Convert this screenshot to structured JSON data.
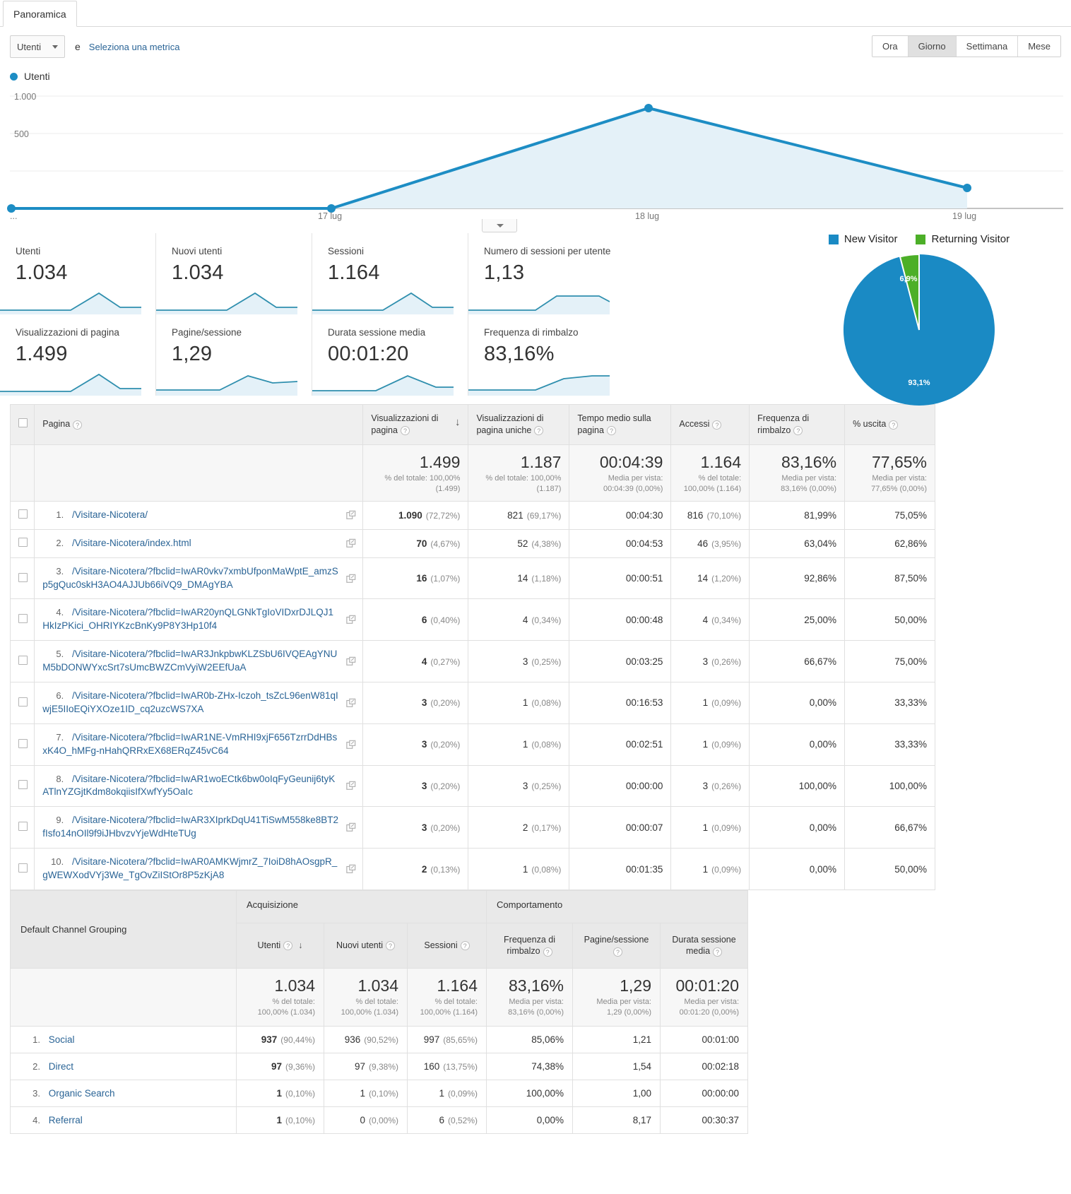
{
  "tab": {
    "label": "Panoramica"
  },
  "controls": {
    "metric_selected": "Utenti",
    "conjunction": "e",
    "select_metric_link": "Seleziona una metrica",
    "granularity": [
      {
        "label": "Ora",
        "active": false
      },
      {
        "label": "Giorno",
        "active": true
      },
      {
        "label": "Settimana",
        "active": false
      },
      {
        "label": "Mese",
        "active": false
      }
    ]
  },
  "chart_data": [
    {
      "type": "area",
      "title": "Utenti",
      "legend": [
        "Utenti"
      ],
      "legend_position": "top-left",
      "x": [
        "...",
        "17 lug",
        "18 lug",
        "19 lug"
      ],
      "series": [
        {
          "name": "Utenti",
          "values": [
            0,
            0,
            870,
            164
          ]
        }
      ],
      "ylim": [
        0,
        1100
      ],
      "yticks": [
        500,
        1000
      ],
      "ytick_labels": [
        "500",
        "1.000"
      ],
      "grid": true,
      "color": "#1d8dc4",
      "fill": "#e4f1f8"
    },
    {
      "type": "pie",
      "title": "",
      "legend_position": "top",
      "labels": [
        "New Visitor",
        "Returning Visitor"
      ],
      "values": [
        93.1,
        6.9
      ],
      "data_labels": [
        "93,1%",
        "6,9%"
      ],
      "colors": [
        "#1a8ac4",
        "#4caf28"
      ]
    }
  ],
  "metric_cards": [
    {
      "label": "Utenti",
      "value": "1.034"
    },
    {
      "label": "Nuovi utenti",
      "value": "1.034"
    },
    {
      "label": "Sessioni",
      "value": "1.164"
    },
    {
      "label": "Numero di sessioni per utente",
      "value": "1,13"
    },
    {
      "label": "Visualizzazioni di pagina",
      "value": "1.499"
    },
    {
      "label": "Pagine/sessione",
      "value": "1,29"
    },
    {
      "label": "Durata sessione media",
      "value": "00:01:20"
    },
    {
      "label": "Frequenza di rimbalzo",
      "value": "83,16%"
    }
  ],
  "pages_table": {
    "columns": [
      "Pagina",
      "Visualizzazioni di pagina",
      "Visualizzazioni di pagina uniche",
      "Tempo medio sulla pagina",
      "Accessi",
      "Frequenza di rimbalzo",
      "% uscita"
    ],
    "sorted_column": "Visualizzazioni di pagina",
    "totals": [
      {
        "big": "1.499",
        "sub": "% del totale: 100,00% (1.499)"
      },
      {
        "big": "1.187",
        "sub": "% del totale: 100,00% (1.187)"
      },
      {
        "big": "00:04:39",
        "sub": "Media per vista: 00:04:39 (0,00%)"
      },
      {
        "big": "1.164",
        "sub": "% del totale: 100,00% (1.164)"
      },
      {
        "big": "83,16%",
        "sub": "Media per vista: 83,16% (0,00%)"
      },
      {
        "big": "77,65%",
        "sub": "Media per vista: 77,65% (0,00%)"
      }
    ],
    "rows": [
      {
        "idx": "1.",
        "url": "/Visitare-Nicotera/",
        "pv": "1.090",
        "pv_pct": "(72,72%)",
        "upv": "821",
        "upv_pct": "(69,17%)",
        "time": "00:04:30",
        "entrances": "816",
        "entrances_pct": "(70,10%)",
        "bounce": "81,99%",
        "exit": "75,05%"
      },
      {
        "idx": "2.",
        "url": "/Visitare-Nicotera/index.html",
        "pv": "70",
        "pv_pct": "(4,67%)",
        "upv": "52",
        "upv_pct": "(4,38%)",
        "time": "00:04:53",
        "entrances": "46",
        "entrances_pct": "(3,95%)",
        "bounce": "63,04%",
        "exit": "62,86%"
      },
      {
        "idx": "3.",
        "url": "/Visitare-Nicotera/?fbclid=IwAR0vkv7xmbUfponMaWptE_amzSp5gQuc0skH3AO4AJJUb66iVQ9_DMAgYBA",
        "pv": "16",
        "pv_pct": "(1,07%)",
        "upv": "14",
        "upv_pct": "(1,18%)",
        "time": "00:00:51",
        "entrances": "14",
        "entrances_pct": "(1,20%)",
        "bounce": "92,86%",
        "exit": "87,50%"
      },
      {
        "idx": "4.",
        "url": "/Visitare-Nicotera/?fbclid=IwAR20ynQLGNkTgIoVIDxrDJLQJ1HkIzPKici_OHRIYKzcBnKy9P8Y3Hp10f4",
        "pv": "6",
        "pv_pct": "(0,40%)",
        "upv": "4",
        "upv_pct": "(0,34%)",
        "time": "00:00:48",
        "entrances": "4",
        "entrances_pct": "(0,34%)",
        "bounce": "25,00%",
        "exit": "50,00%"
      },
      {
        "idx": "5.",
        "url": "/Visitare-Nicotera/?fbclid=IwAR3JnkpbwKLZSbU6IVQEAgYNUM5bDONWYxcSrt7sUmcBWZCmVyiW2EEfUaA",
        "pv": "4",
        "pv_pct": "(0,27%)",
        "upv": "3",
        "upv_pct": "(0,25%)",
        "time": "00:03:25",
        "entrances": "3",
        "entrances_pct": "(0,26%)",
        "bounce": "66,67%",
        "exit": "75,00%"
      },
      {
        "idx": "6.",
        "url": "/Visitare-Nicotera/?fbclid=IwAR0b-ZHx-Iczoh_tsZcL96enW81qIwjE5IIoEQiYXOze1ID_cq2uzcWS7XA",
        "pv": "3",
        "pv_pct": "(0,20%)",
        "upv": "1",
        "upv_pct": "(0,08%)",
        "time": "00:16:53",
        "entrances": "1",
        "entrances_pct": "(0,09%)",
        "bounce": "0,00%",
        "exit": "33,33%"
      },
      {
        "idx": "7.",
        "url": "/Visitare-Nicotera/?fbclid=IwAR1NE-VmRHI9xjF656TzrrDdHBsxK4O_hMFg-nHahQRRxEX68ERqZ45vC64",
        "pv": "3",
        "pv_pct": "(0,20%)",
        "upv": "1",
        "upv_pct": "(0,08%)",
        "time": "00:02:51",
        "entrances": "1",
        "entrances_pct": "(0,09%)",
        "bounce": "0,00%",
        "exit": "33,33%"
      },
      {
        "idx": "8.",
        "url": "/Visitare-Nicotera/?fbclid=IwAR1woECtk6bw0oIqFyGeunij6tyKATlnYZGjtKdm8okqiisIfXwfYy5OaIc",
        "pv": "3",
        "pv_pct": "(0,20%)",
        "upv": "3",
        "upv_pct": "(0,25%)",
        "time": "00:00:00",
        "entrances": "3",
        "entrances_pct": "(0,26%)",
        "bounce": "100,00%",
        "exit": "100,00%"
      },
      {
        "idx": "9.",
        "url": "/Visitare-Nicotera/?fbclid=IwAR3XIprkDqU41TiSwM558ke8BT2fIsfo14nOIl9f9iJHbvzvYjeWdHteTUg",
        "pv": "3",
        "pv_pct": "(0,20%)",
        "upv": "2",
        "upv_pct": "(0,17%)",
        "time": "00:00:07",
        "entrances": "1",
        "entrances_pct": "(0,09%)",
        "bounce": "0,00%",
        "exit": "66,67%"
      },
      {
        "idx": "10.",
        "url": "/Visitare-Nicotera/?fbclid=IwAR0AMKWjmrZ_7IoiD8hAOsgpR_gWEWXodVYj3We_TgOvZiIStOr8P5zKjA8",
        "pv": "2",
        "pv_pct": "(0,13%)",
        "upv": "1",
        "upv_pct": "(0,08%)",
        "time": "00:01:35",
        "entrances": "1",
        "entrances_pct": "(0,09%)",
        "bounce": "0,00%",
        "exit": "50,00%"
      }
    ]
  },
  "channel_table": {
    "dimension": "Default Channel Grouping",
    "group_acquisition": "Acquisizione",
    "group_behavior": "Comportamento",
    "columns": [
      "Utenti",
      "Nuovi utenti",
      "Sessioni",
      "Frequenza di rimbalzo",
      "Pagine/sessione",
      "Durata sessione media"
    ],
    "sorted_column": "Utenti",
    "totals": [
      {
        "big": "1.034",
        "sub1": "% del totale:",
        "sub2": "100,00% (1.034)"
      },
      {
        "big": "1.034",
        "sub1": "% del totale:",
        "sub2": "100,00% (1.034)"
      },
      {
        "big": "1.164",
        "sub1": "% del totale:",
        "sub2": "100,00% (1.164)"
      },
      {
        "big": "83,16%",
        "sub1": "Media per vista:",
        "sub2": "83,16% (0,00%)"
      },
      {
        "big": "1,29",
        "sub1": "Media per vista:",
        "sub2": "1,29 (0,00%)"
      },
      {
        "big": "00:01:20",
        "sub1": "Media per vista:",
        "sub2": "00:01:20 (0,00%)"
      }
    ],
    "rows": [
      {
        "idx": "1.",
        "channel": "Social",
        "users": "937",
        "users_pct": "(90,44%)",
        "newusers": "936",
        "newusers_pct": "(90,52%)",
        "sessions": "997",
        "sessions_pct": "(85,65%)",
        "bounce": "85,06%",
        "ppv": "1,21",
        "dur": "00:01:00"
      },
      {
        "idx": "2.",
        "channel": "Direct",
        "users": "97",
        "users_pct": "(9,36%)",
        "newusers": "97",
        "newusers_pct": "(9,38%)",
        "sessions": "160",
        "sessions_pct": "(13,75%)",
        "bounce": "74,38%",
        "ppv": "1,54",
        "dur": "00:02:18"
      },
      {
        "idx": "3.",
        "channel": "Organic Search",
        "users": "1",
        "users_pct": "(0,10%)",
        "newusers": "1",
        "newusers_pct": "(0,10%)",
        "sessions": "1",
        "sessions_pct": "(0,09%)",
        "bounce": "100,00%",
        "ppv": "1,00",
        "dur": "00:00:00"
      },
      {
        "idx": "4.",
        "channel": "Referral",
        "users": "1",
        "users_pct": "(0,10%)",
        "newusers": "0",
        "newusers_pct": "(0,00%)",
        "sessions": "6",
        "sessions_pct": "(0,52%)",
        "bounce": "0,00%",
        "ppv": "8,17",
        "dur": "00:30:37"
      }
    ]
  }
}
